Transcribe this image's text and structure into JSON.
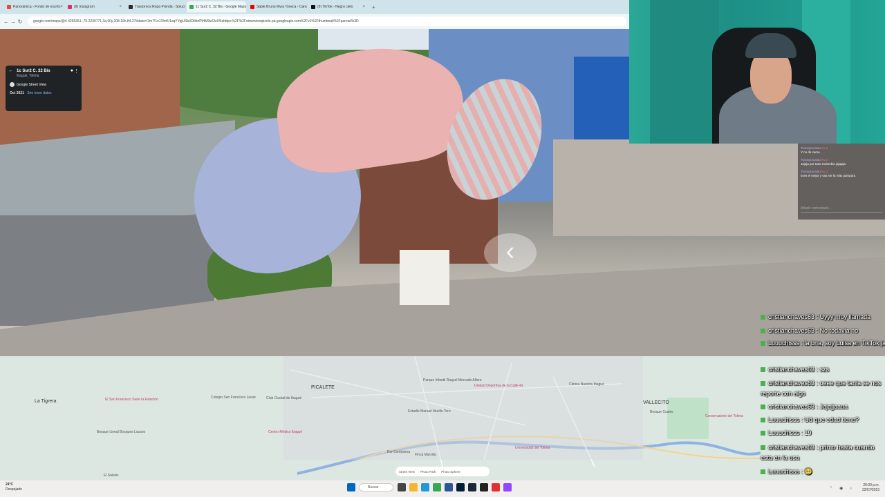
{
  "browser": {
    "tabs": [
      {
        "label": "Panorámica - Fondo de escrito",
        "color": "#e94b35"
      },
      {
        "label": "(9) Instagram",
        "color": "#d6336c"
      },
      {
        "label": "Trastornos Ropa Prenda - Solución",
        "color": "#2b2b2b"
      },
      {
        "label": "1c Sur2 C. 32 Bis - Google Maps",
        "color": "#34a853",
        "active": true
      },
      {
        "label": "Sable Bruno Myra Toneca - Canal",
        "color": "#e00"
      },
      {
        "label": "(9) TikTok - Negro cielo",
        "color": "#111"
      }
    ],
    "new_tab": "+",
    "url": "google.com/maps/@4.4265351,-75.2239771,3a,90y,208.16h,84.27t/data=!3m7!1e1!3m5!1sqYYpjUSbXDthinPlHM9w!2e0!6shttps:%2F%2Fstreetviewpixels-pa.googleapis.com%2Fv1%2Fthumbnail%3Fpanoid%3D"
  },
  "streetview": {
    "address": "1c Sur2 C. 32 Bis",
    "city": "Ibagué, Tolima",
    "provider": "Google Street View",
    "date": "Oct 2021",
    "see_more": "See more dates"
  },
  "tiktok": {
    "messages": [
      {
        "user": "Twiceprocastu",
        "badge": "Nv 2",
        "text": "Y no de carne"
      },
      {
        "user": "Twiceprocastu",
        "badge": "Nv 2",
        "text": "Jajaja por todo Colombia jajajaja"
      },
      {
        "user": "Twiceprocastu",
        "badge": "Nv 2",
        "text": "Eres el mejor y vas ser la más pampara"
      }
    ],
    "input_placeholder": "Añadir comentario..."
  },
  "twitch": {
    "messages": [
      {
        "user": "cristianchaves63",
        "text": "Uyyy muy llamada"
      },
      {
        "user": "cristianchaves63",
        "text": "No todavia no"
      },
      {
        "user": "Luuuchisss",
        "text": "la bna, soy Luisa en TikTok jaja"
      },
      {
        "user": "cristianchaves63",
        "text": "szs"
      },
      {
        "user": "cristianchaves63",
        "text": "oeee que tania se nos reporte con algo"
      },
      {
        "user": "cristianchaves63",
        "text": "Jajajjaaua"
      },
      {
        "user": "Luuuchisss",
        "text": "Ud que edad tiene?"
      },
      {
        "user": "Luuuchisss",
        "text": "19"
      },
      {
        "user": "cristianchaves63",
        "text": "primo hasta cuando esta en la usa"
      },
      {
        "user": "Luuuchisss",
        "text": "🥹"
      }
    ]
  },
  "map": {
    "labels": [
      {
        "text": "La Tigrera",
        "big": true
      },
      {
        "text": "El San Francisco Sede la Estación"
      },
      {
        "text": "Bosque Lineal Bosques Lozano"
      },
      {
        "text": "Colegio San Francisco Javier"
      },
      {
        "text": "Club Ciudad de Ibagué"
      },
      {
        "text": "Centro Médico Ibagué"
      },
      {
        "text": "PICALETE",
        "big": true
      },
      {
        "text": "Parque Infantil Raquel Mercado Alfaro"
      },
      {
        "text": "Estadio Manuel Murillo Toro"
      },
      {
        "text": "Unidad Deportiva de la Calle 42"
      },
      {
        "text": "Clínica Nuestra Ibagué"
      },
      {
        "text": "VALLECITO",
        "big": true
      },
      {
        "text": "Bosque Cuarto"
      },
      {
        "text": "Universidad del Tolima"
      },
      {
        "text": "Finca Marsilia"
      },
      {
        "text": "Rio Combeima"
      },
      {
        "text": "El Salado"
      },
      {
        "text": "Conservatorio del Tolima"
      }
    ],
    "controls": [
      "Street View",
      "Photo Path",
      "Photo Sphere"
    ]
  },
  "taskbar": {
    "weather_temp": "24°C",
    "weather_desc": "Despejado",
    "search_label": "Buscar",
    "time": "20:00 p.m.",
    "date": "22/07/2023"
  },
  "colors": {
    "accent": "#4caf50",
    "map_bg": "#dde7e2"
  }
}
